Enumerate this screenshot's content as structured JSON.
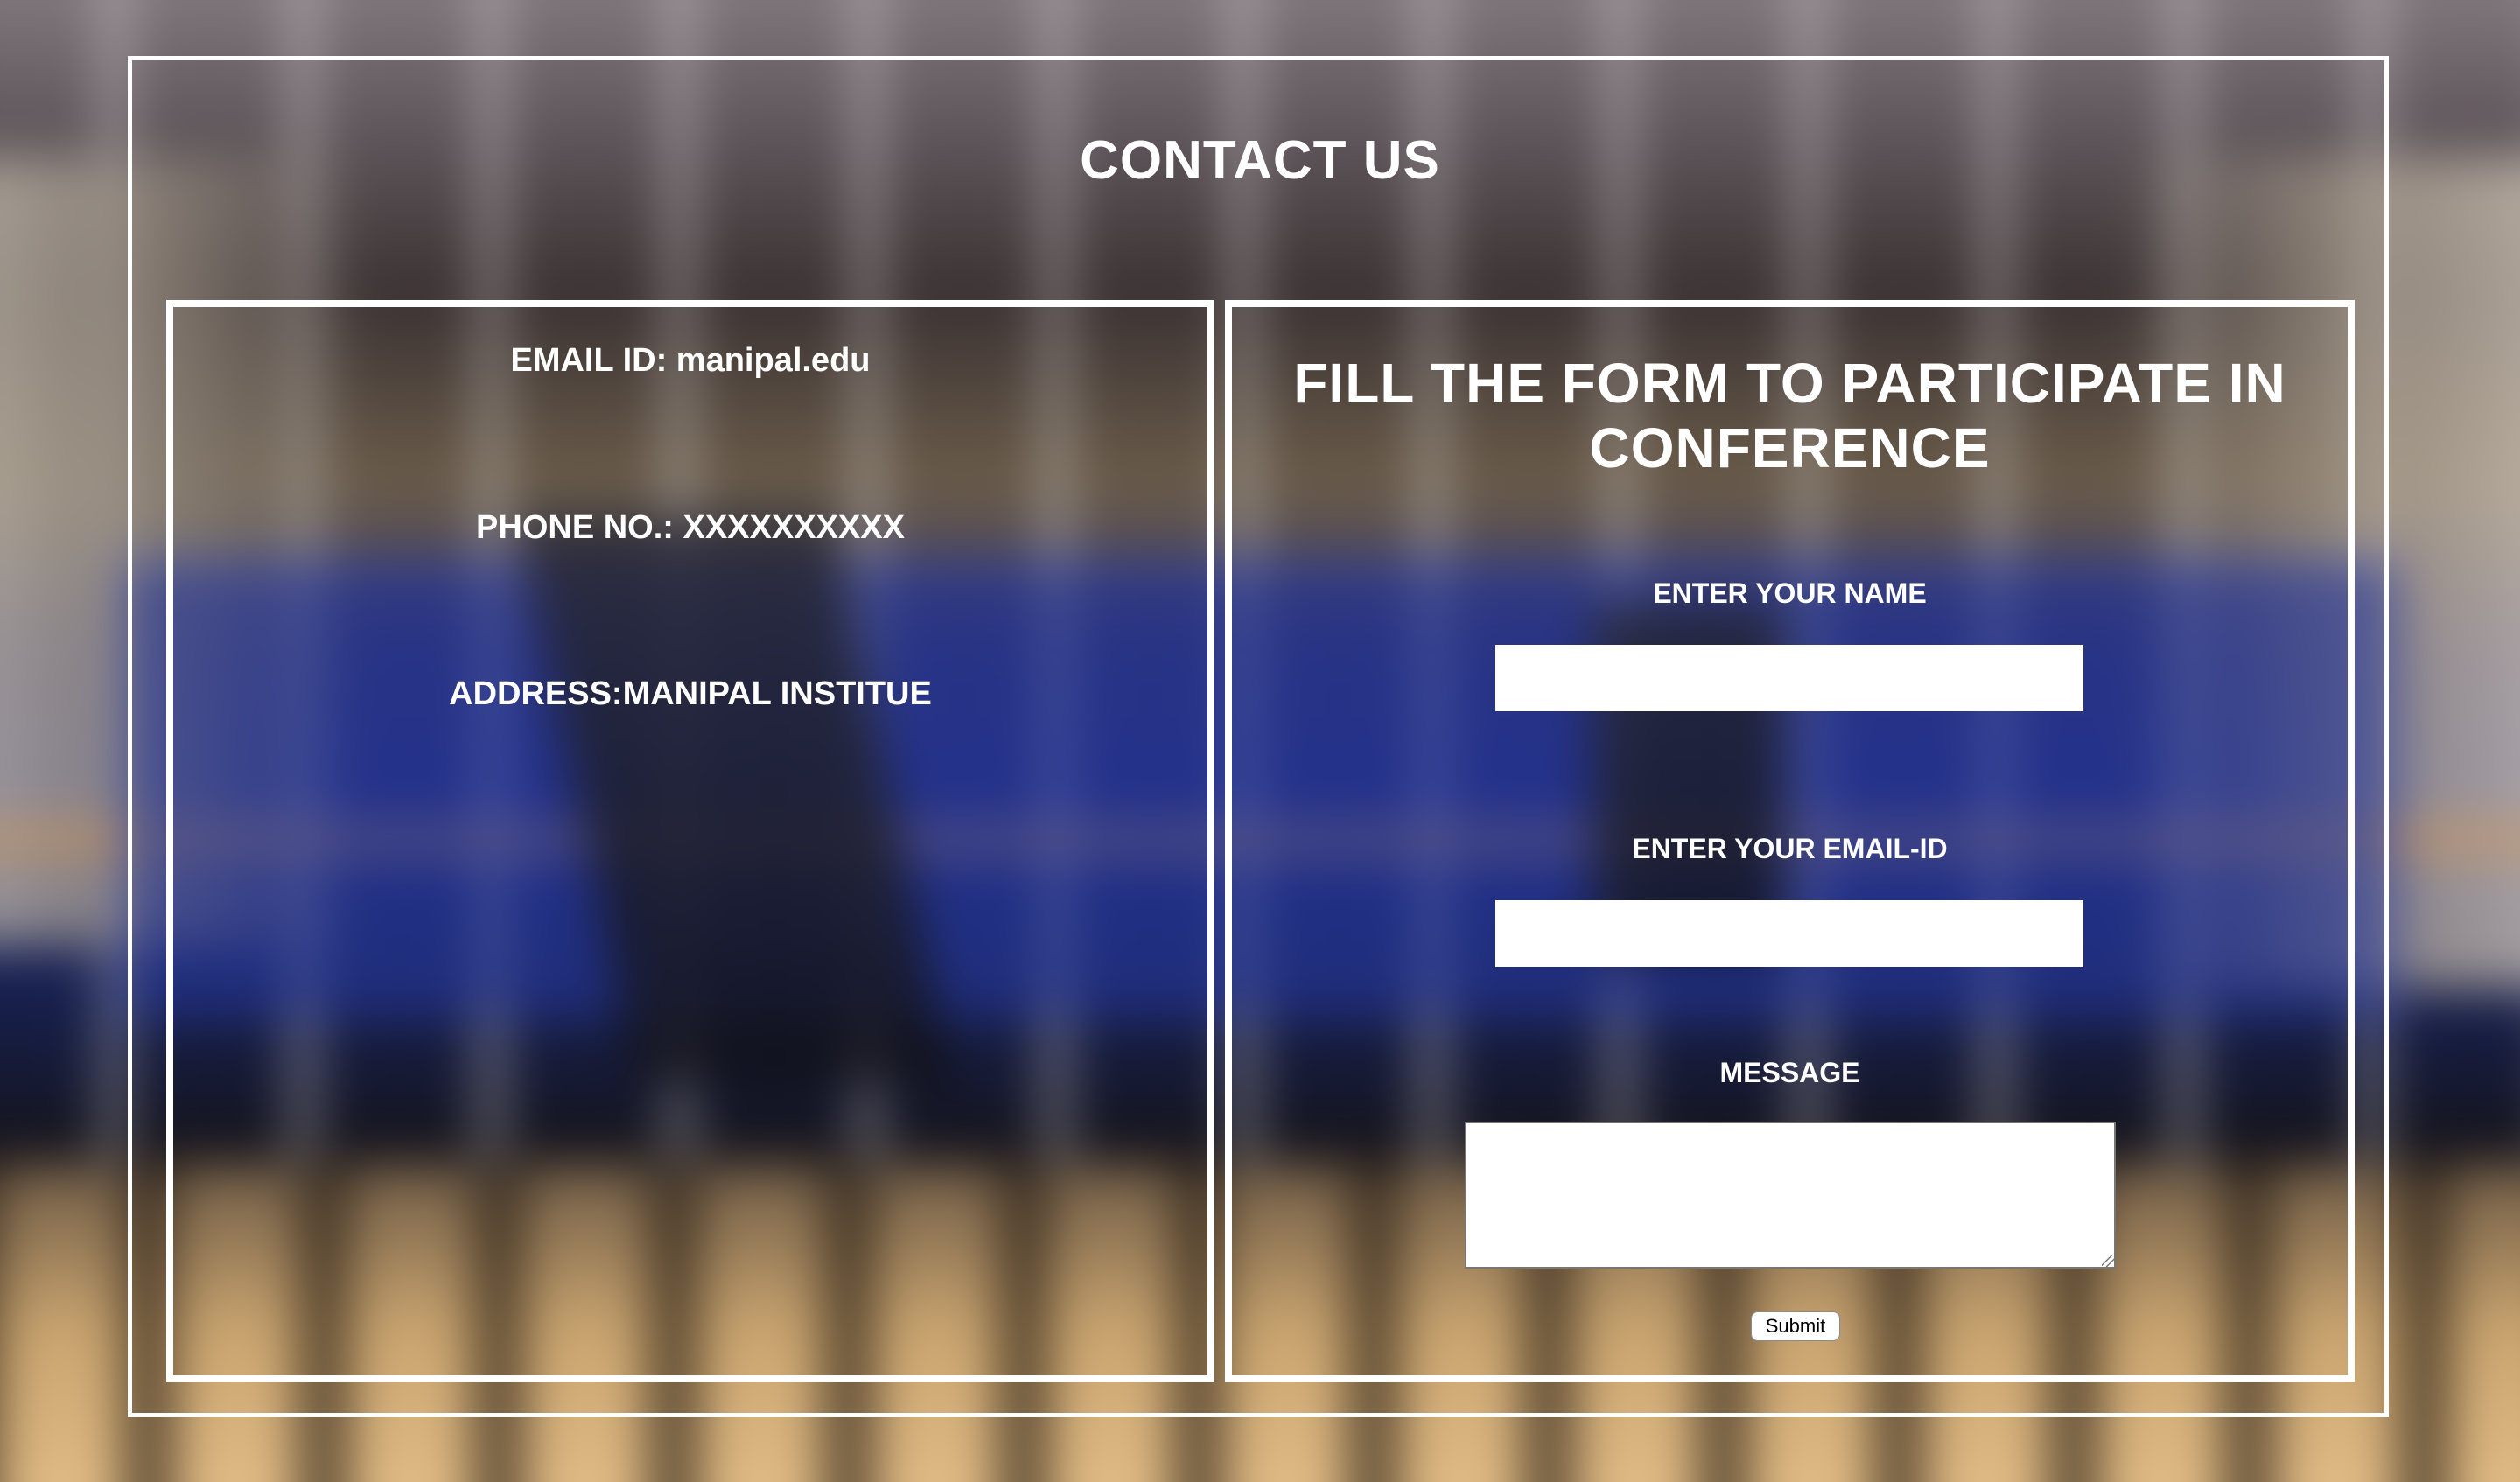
{
  "page": {
    "title": "CONTACT US"
  },
  "contact_info": {
    "email": "EMAIL ID: manipal.edu",
    "phone": "PHONE NO.: XXXXXXXXXX",
    "address": "ADDRESS:MANIPAL INSTITUE"
  },
  "form": {
    "title_line1": "FILL THE FORM TO PARTICIPATE IN",
    "title_line2": "CONFERENCE",
    "name_label": "ENTER YOUR NAME",
    "name_value": "",
    "email_label": "ENTER YOUR EMAIL-ID",
    "email_value": "",
    "message_label": "MESSAGE",
    "message_value": "",
    "submit_label": "Submit"
  },
  "colors": {
    "text": "#ffffff",
    "border": "#ffffff",
    "input_bg": "#ffffff"
  }
}
